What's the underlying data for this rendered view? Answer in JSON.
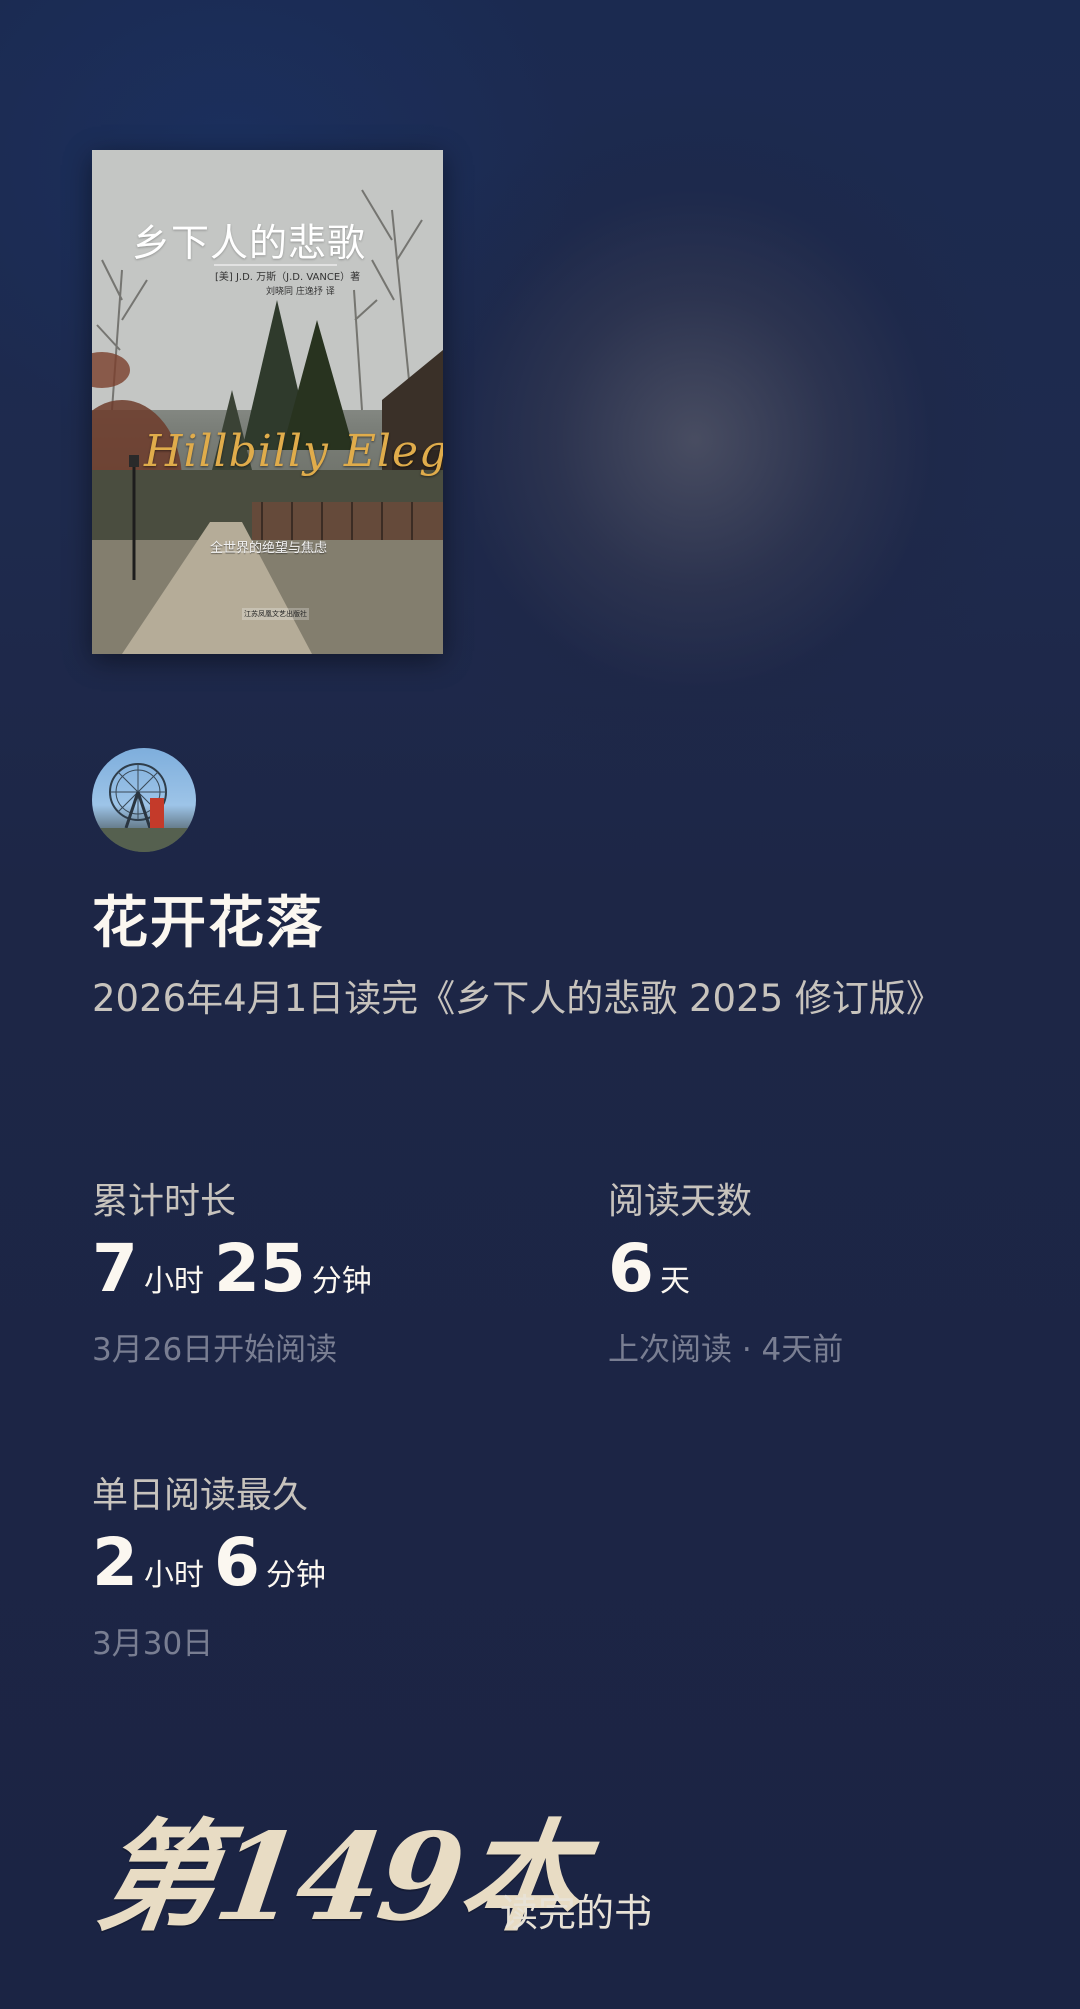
{
  "book": {
    "cover": {
      "cn_title": "乡下人的悲歌",
      "author_line": "[美] J.D. 万斯（J.D. VANCE）著",
      "translator_line": "刘晓同 庄逸抒 译",
      "en_title": "Hillbilly Elegy",
      "subtitle": "全世界的绝望与焦虑",
      "publisher": "江苏凤凰文艺出版社"
    }
  },
  "user": {
    "name": "花开花落"
  },
  "summary": {
    "finish_line": "2026年4月1日读完《乡下人的悲歌 2025 修订版》"
  },
  "stats": {
    "total_time": {
      "label": "累计时长",
      "hours": "7",
      "hours_unit": "小时",
      "minutes": "25",
      "minutes_unit": "分钟",
      "sub": "3月26日开始阅读"
    },
    "reading_days": {
      "label": "阅读天数",
      "days": "6",
      "days_unit": "天",
      "sub": "上次阅读 · 4天前"
    },
    "longest_day": {
      "label": "单日阅读最久",
      "hours": "2",
      "hours_unit": "小时",
      "minutes": "6",
      "minutes_unit": "分钟",
      "sub": "3月30日"
    }
  },
  "milestone": {
    "count_text": "第149本",
    "suffix": "读完的书"
  },
  "colors": {
    "background": "#1d2646",
    "primary_text": "#fbf7f0",
    "secondary_text": "#c7c3bd",
    "muted_text": "#797e92",
    "cover_title_gold": "#e0ac4b"
  }
}
